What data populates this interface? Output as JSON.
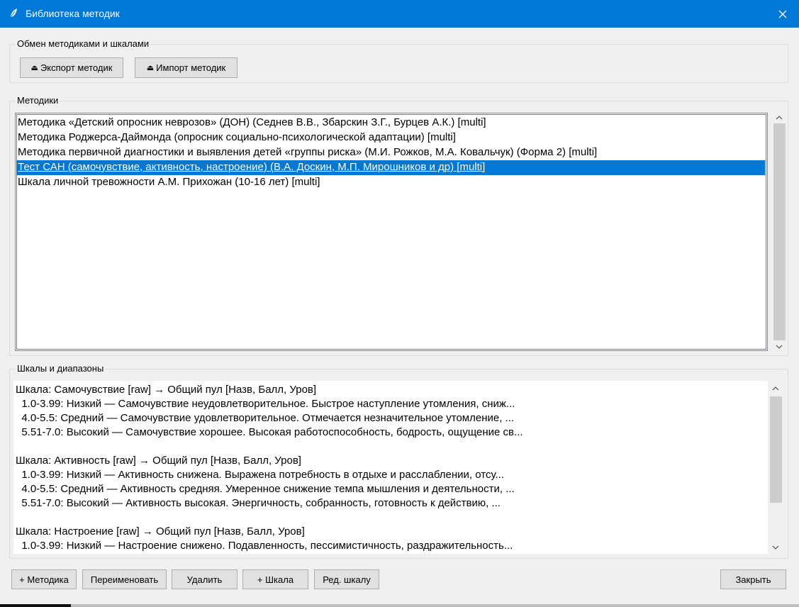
{
  "window": {
    "title": "Библиотека методик",
    "titlebar_color": "#0078d7"
  },
  "exchange": {
    "group_label": "Обмен методиками и шкалами",
    "export_label": "Экспорт методик",
    "import_label": "Импорт методик"
  },
  "methods": {
    "group_label": "Методики",
    "selected_index": 3,
    "items": [
      "Методика «Детский опросник неврозов» (ДОН) (Седнев В.В., Збарскин З.Г., Бурцев А.К.) [multi]",
      "Методика Роджерса-Даймонда (опросник социально-психологической адаптации) [multi]",
      "Методика первичной диагностики и выявления детей «группы риска» (М.И. Рожков, М.А. Ковальчук) (Форма 2) [multi]",
      "Тест САН (самочувствие, активность, настроение) (В.А. Доскин, М.П. Мирошников и др) [multi]",
      "Шкала личной тревожности А.М. Прихожан (10-16 лет) [multi]"
    ]
  },
  "scales": {
    "group_label": "Шкалы и диапазоны",
    "lines": [
      "Шкала: Самочувствие [raw] → Общий пул [Назв, Балл, Уров]",
      "  1.0-3.99: Низкий — Самочувствие неудовлетворительное. Быстрое наступление утомления, сниж...",
      "  4.0-5.5: Средний — Самочувствие удовлетворительное. Отмечается незначительное утомление, ...",
      "  5.51-7.0: Высокий — Самочувствие хорошее. Высокая работоспособность, бодрость, ощущение св...",
      "",
      "Шкала: Активность [raw] → Общий пул [Назв, Балл, Уров]",
      "  1.0-3.99: Низкий — Активность снижена. Выражена потребность в отдыхе и расслаблении, отсу...",
      "  4.0-5.5: Средний — Активность средняя. Умеренное снижение темпа мышления и деятельности, ...",
      "  5.51-7.0: Высокий — Активность высокая. Энергичность, собранность, готовность к действию, ...",
      "",
      "Шкала: Настроение [raw] → Общий пул [Назв, Балл, Уров]",
      "  1.0-3.99: Низкий — Настроение снижено. Подавленность, пессимистичность, раздражительность..."
    ]
  },
  "actions": {
    "add_method": "+ Методика",
    "rename": "Переименовать",
    "delete": "Удалить",
    "add_scale": "+ Шкала",
    "edit_scale": "Ред. шкалу",
    "close": "Закрыть"
  }
}
